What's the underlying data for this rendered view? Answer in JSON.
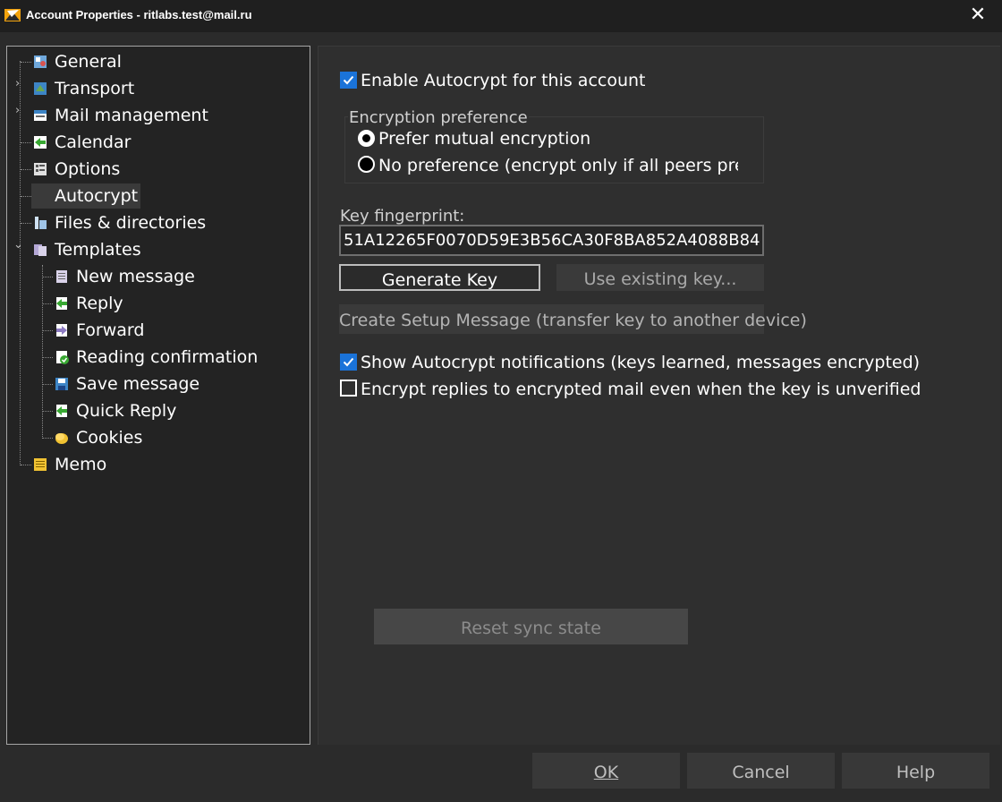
{
  "window": {
    "title": "Account Properties - ritlabs.test@mail.ru",
    "close_glyph": "✕"
  },
  "tree": {
    "items": [
      {
        "label": "General",
        "icon": "general-icon"
      },
      {
        "label": "Transport",
        "icon": "transport-icon",
        "expander": ">"
      },
      {
        "label": "Mail management",
        "icon": "mail-management-icon",
        "expander": ">"
      },
      {
        "label": "Calendar",
        "icon": "calendar-icon"
      },
      {
        "label": "Options",
        "icon": "options-icon"
      },
      {
        "label": "Autocrypt",
        "icon": "none",
        "selected": true
      },
      {
        "label": "Files & directories",
        "icon": "files-icon"
      },
      {
        "label": "Templates",
        "icon": "templates-icon",
        "expander": "v"
      },
      {
        "label": "New message",
        "icon": "new-message-icon"
      },
      {
        "label": "Reply",
        "icon": "reply-icon"
      },
      {
        "label": "Forward",
        "icon": "forward-icon"
      },
      {
        "label": "Reading confirmation",
        "icon": "reading-confirmation-icon"
      },
      {
        "label": "Save message",
        "icon": "save-message-icon"
      },
      {
        "label": "Quick Reply",
        "icon": "quick-reply-icon"
      },
      {
        "label": "Cookies",
        "icon": "cookies-icon"
      },
      {
        "label": "Memo",
        "icon": "memo-icon"
      }
    ]
  },
  "autocrypt": {
    "enable_label": "Enable Autocrypt for this account",
    "enable_checked": true,
    "encryption_group_label": "Encryption preference",
    "option_mutual": "Prefer mutual encryption",
    "option_mutual_selected": true,
    "option_none": "No preference (encrypt only if all peers prefer i",
    "fingerprint_label": "Key fingerprint:",
    "fingerprint_value": "51A12265F0070D59E3B56CA30F8BA852A4088B84",
    "generate_key": "Generate Key",
    "use_existing_key": "Use existing key...",
    "create_setup": "Create Setup Message (transfer key to another device)",
    "show_notifications_label": "Show Autocrypt notifications (keys learned, messages encrypted)",
    "show_notifications_checked": true,
    "encrypt_replies_label": "Encrypt replies to encrypted mail even when the key is unverified",
    "encrypt_replies_checked": false,
    "reset_sync": "Reset sync state"
  },
  "footer": {
    "ok": "OK",
    "cancel": "Cancel",
    "help": "Help"
  },
  "colors": {
    "accent": "#1a73d9",
    "background": "#2b2b2b",
    "panel": "#232323"
  }
}
